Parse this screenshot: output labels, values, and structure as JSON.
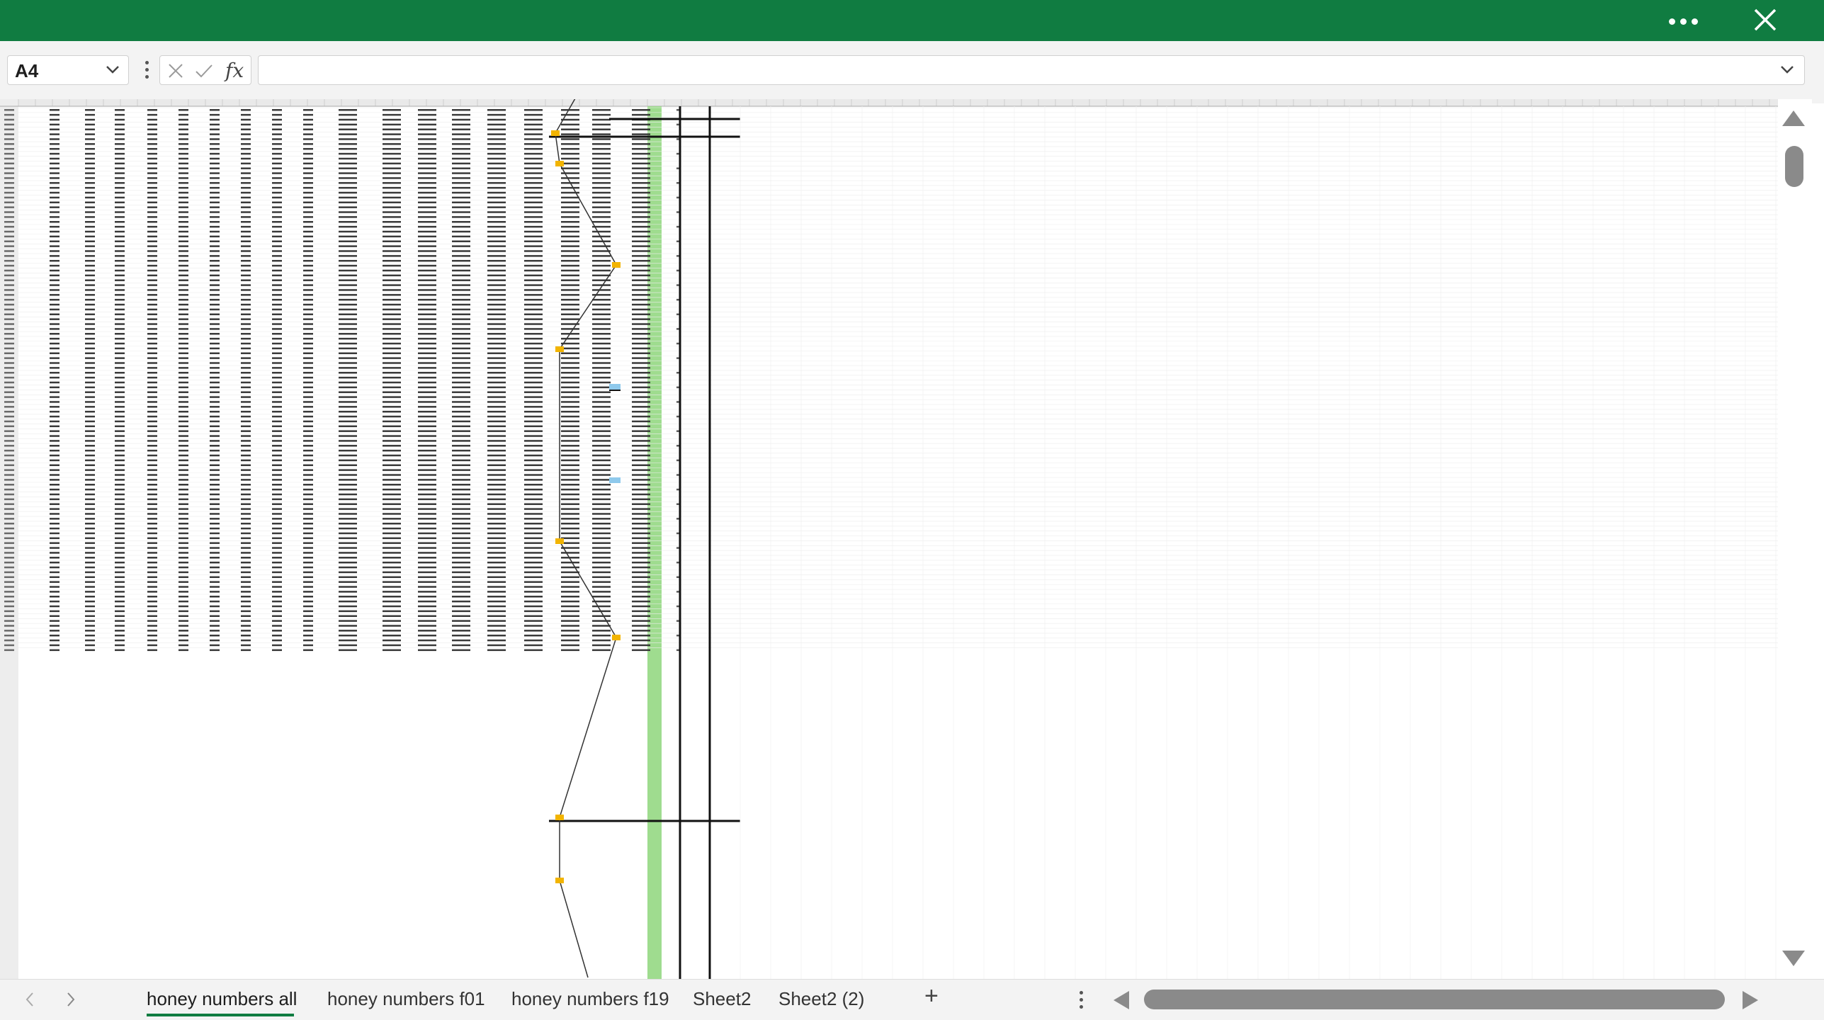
{
  "titlebar": {
    "more_icon": "more-horizontal-icon",
    "close_icon": "close-icon",
    "color": "#107c41"
  },
  "formula_bar": {
    "name_box_value": "A4",
    "fx_label": "fx",
    "formula_value": ""
  },
  "sheet_tabs": [
    {
      "label": "honey numbers all",
      "active": true
    },
    {
      "label": "honey numbers f01",
      "active": false
    },
    {
      "label": "honey numbers f19",
      "active": false
    },
    {
      "label": "Sheet2",
      "active": false
    },
    {
      "label": "Sheet2 (2)",
      "active": false
    }
  ],
  "bottom": {
    "add_sheet_label": "+"
  },
  "grid": {
    "first_row": 30,
    "last_row": 141,
    "highlight_column_color": "#9fdc8f",
    "marker_color": "#f2b400",
    "selection_color": "#8ec9ec"
  }
}
